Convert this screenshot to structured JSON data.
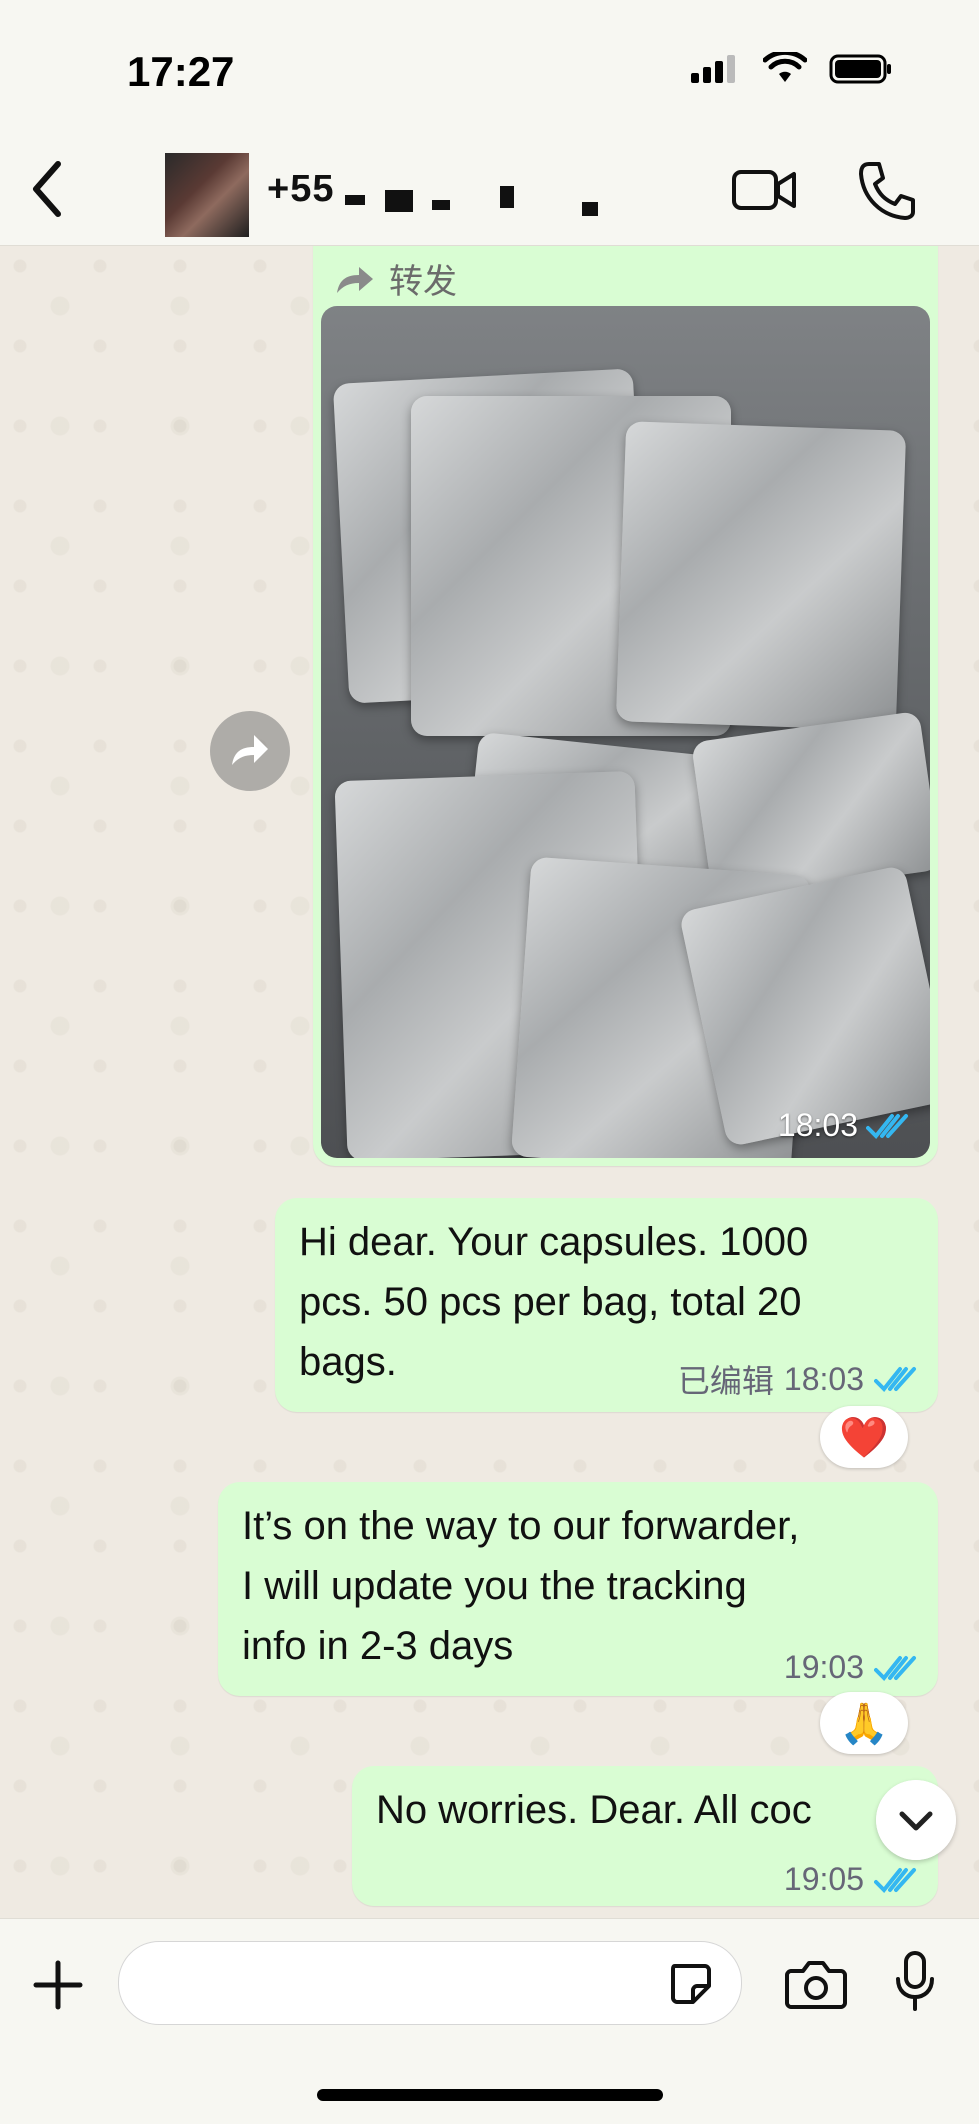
{
  "status_bar": {
    "time": "17:27"
  },
  "header": {
    "contact_name": "+55"
  },
  "messages": {
    "forwarded_label": "转发",
    "photo_time": "18:03",
    "m1_line1": "Hi dear. Your capsules. 1000",
    "m1_line2": "pcs. 50 pcs per bag, total 20",
    "m1_line3": "bags.",
    "m1_edited": "已编辑",
    "m1_time": "18:03",
    "m1_reaction": "❤️",
    "m2_line1": "It’s on the way to our forwarder,",
    "m2_line2": "I will update you the tracking",
    "m2_line3": "info in 2-3 days",
    "m2_time": "19:03",
    "m2_reaction": "🙏",
    "m3_line1": "No worries. Dear. All coc",
    "m3_time": "19:05"
  },
  "colors": {
    "bubble_out": "#d9fdd3",
    "chat_bg": "#efeae2",
    "read_tick": "#34b7f1"
  },
  "icons": [
    "back-chevron-icon",
    "video-camera-icon",
    "phone-icon",
    "forward-arrow-icon",
    "double-check-icon",
    "chevron-down-icon",
    "plus-icon",
    "sticker-icon",
    "camera-icon",
    "microphone-icon"
  ]
}
